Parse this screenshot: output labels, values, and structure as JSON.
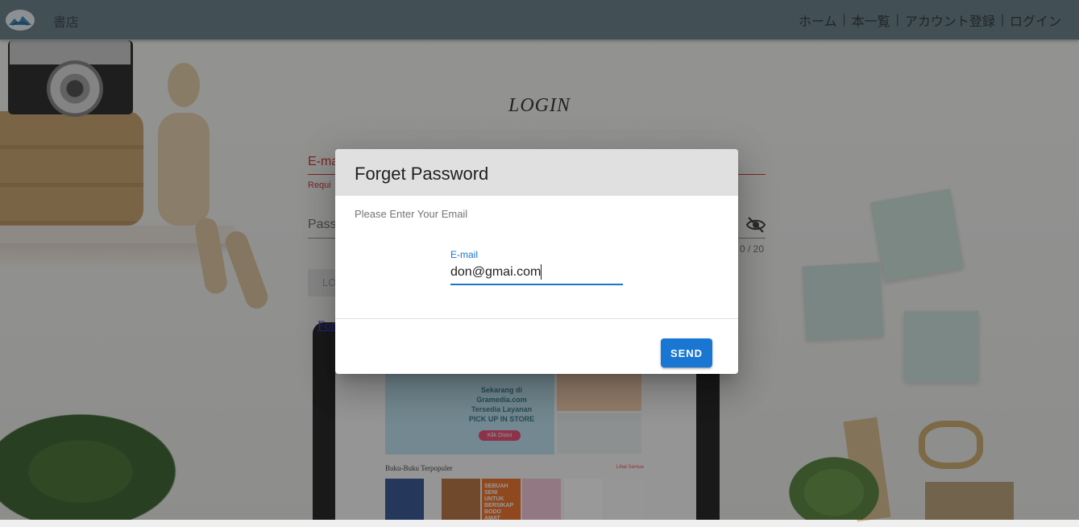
{
  "navbar": {
    "brand": "書店",
    "links": [
      "ホーム",
      "本一覧",
      "アカウント登録",
      "ログイン"
    ],
    "separator": "|"
  },
  "login": {
    "title": "LOGIN",
    "email_label": "E-ma",
    "required_hint": "Requi",
    "password_label": "Pass",
    "counter": "0 / 20",
    "login_button": "LO",
    "forgot_link": "For"
  },
  "background_shop": {
    "banner_text": "Sekarang di Gramedia.com Tersedia Layanan PICK UP IN STORE",
    "banner_button": "Klik Disini",
    "section_title": "Buku-Buku Terpopuler",
    "section_more": "Lihat Semua",
    "book3_title": "SEBUAH SENI UNTUK BERSIKAP BODO AMAT"
  },
  "dialog": {
    "title": "Forget Password",
    "subtitle": "Please Enter Your Email",
    "field_label": "E-mail",
    "field_value": "don@gmai.com",
    "send_button": "SEND"
  },
  "colors": {
    "navbar": "#5f7681",
    "primary": "#1976d2",
    "error": "#c62828"
  },
  "icons": [
    "logo-icon",
    "visibility-off-icon"
  ]
}
